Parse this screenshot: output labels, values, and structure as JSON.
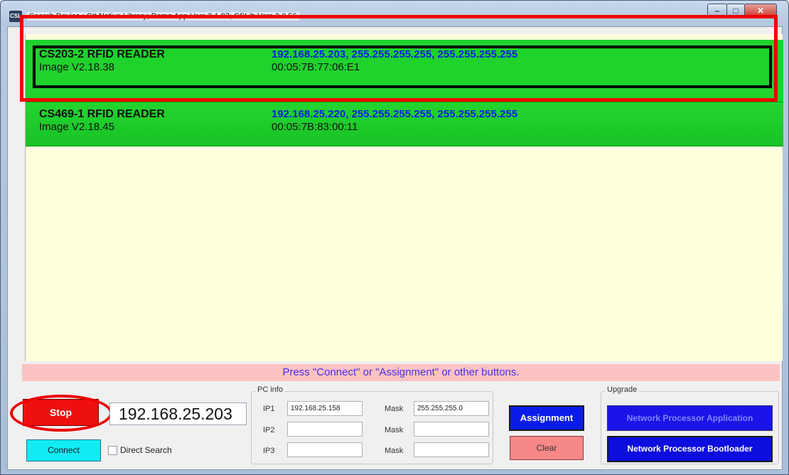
{
  "window": {
    "title": "Search Device : C# Native Library; Demo App Vers 3.1.87; CSLib Vers 3.0.56",
    "icon": "app-icon",
    "icon_text": "CSL",
    "controls": {
      "minimize": "–",
      "maximize": "□",
      "close": "✕"
    }
  },
  "devices": [
    {
      "name": "CS203-2 RFID READER",
      "image": "Image V2.18.38",
      "ips": "192.168.25.203, 255.255.255.255, 255.255.255.255",
      "mac": "00:05:7B:77:06:E1",
      "selected": true
    },
    {
      "name": "CS469-1 RFID READER",
      "image": "Image V2.18.45",
      "ips": "192.168.25.220, 255.255.255.255, 255.255.255.255",
      "mac": "00:05:7B:83:00:11",
      "selected": false
    }
  ],
  "status": "Press \"Connect\" or \"Assignment\" or other buttons.",
  "controls": {
    "stop_label": "Stop",
    "ip_display": "192.168.25.203",
    "connect_label": "Connect",
    "direct_search_label": "Direct Search",
    "direct_search_checked": false
  },
  "pc_info": {
    "title": "PC info",
    "rows": [
      {
        "ip_label": "IP1",
        "ip_value": "192.168.25.158",
        "mask_label": "Mask",
        "mask_value": "255.255.255.0"
      },
      {
        "ip_label": "IP2",
        "ip_value": "",
        "mask_label": "Mask",
        "mask_value": ""
      },
      {
        "ip_label": "IP3",
        "ip_value": "",
        "mask_label": "Mask",
        "mask_value": ""
      }
    ]
  },
  "actions": {
    "assignment_label": "Assignment",
    "clear_label": "Clear"
  },
  "upgrade": {
    "title": "Upgrade",
    "application_label": "Network Processor Application",
    "bootloader_label": "Network Processor Bootloader"
  },
  "colors": {
    "device_row": "#1fd22c",
    "ip_text": "#0b1ce8",
    "list_background": "#fffedd",
    "status_background": "#fcc2c2",
    "highlight_annotation": "#ee0000"
  }
}
